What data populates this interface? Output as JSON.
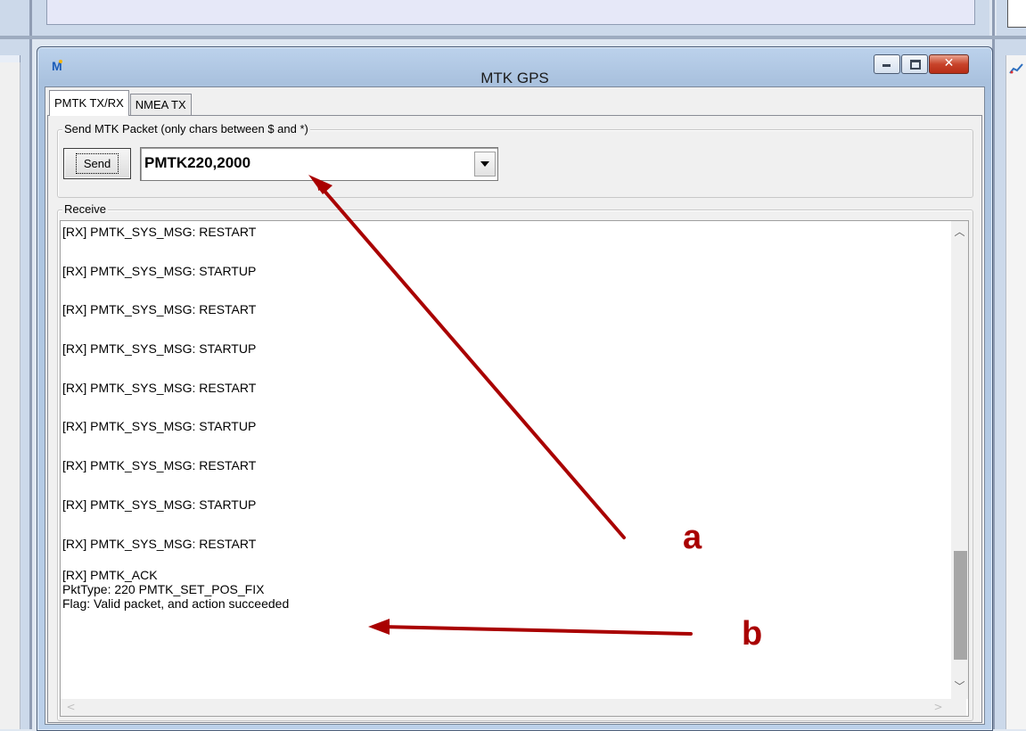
{
  "window": {
    "title": "MTK GPS",
    "icon_letter": "M",
    "controls": {
      "minimize": "minimize-icon",
      "maximize": "maximize-icon",
      "close": "close-icon"
    }
  },
  "tabs": [
    {
      "label": "PMTK TX/RX",
      "active": true
    },
    {
      "label": "NMEA TX",
      "active": false
    }
  ],
  "send_group": {
    "title": "Send MTK Packet (only chars between $ and *)",
    "button_label": "Send",
    "packet_value": "PMTK220,2000"
  },
  "receive_group": {
    "title": "Receive",
    "lines": [
      "[RX] PMTK_SYS_MSG: RESTART",
      "[RX] PMTK_SYS_MSG: STARTUP",
      "[RX] PMTK_SYS_MSG: RESTART",
      "[RX] PMTK_SYS_MSG: STARTUP",
      "[RX] PMTK_SYS_MSG: RESTART",
      "[RX] PMTK_SYS_MSG: STARTUP",
      "[RX] PMTK_SYS_MSG: RESTART",
      "[RX] PMTK_SYS_MSG: STARTUP",
      "[RX] PMTK_SYS_MSG: RESTART"
    ],
    "ack_block": [
      "[RX] PMTK_ACK",
      "PktType: 220 PMTK_SET_POS_FIX",
      "Flag: Valid packet, and action succeeded"
    ]
  },
  "annotations": {
    "color": "#a90000",
    "labels": [
      "a",
      "b"
    ]
  }
}
